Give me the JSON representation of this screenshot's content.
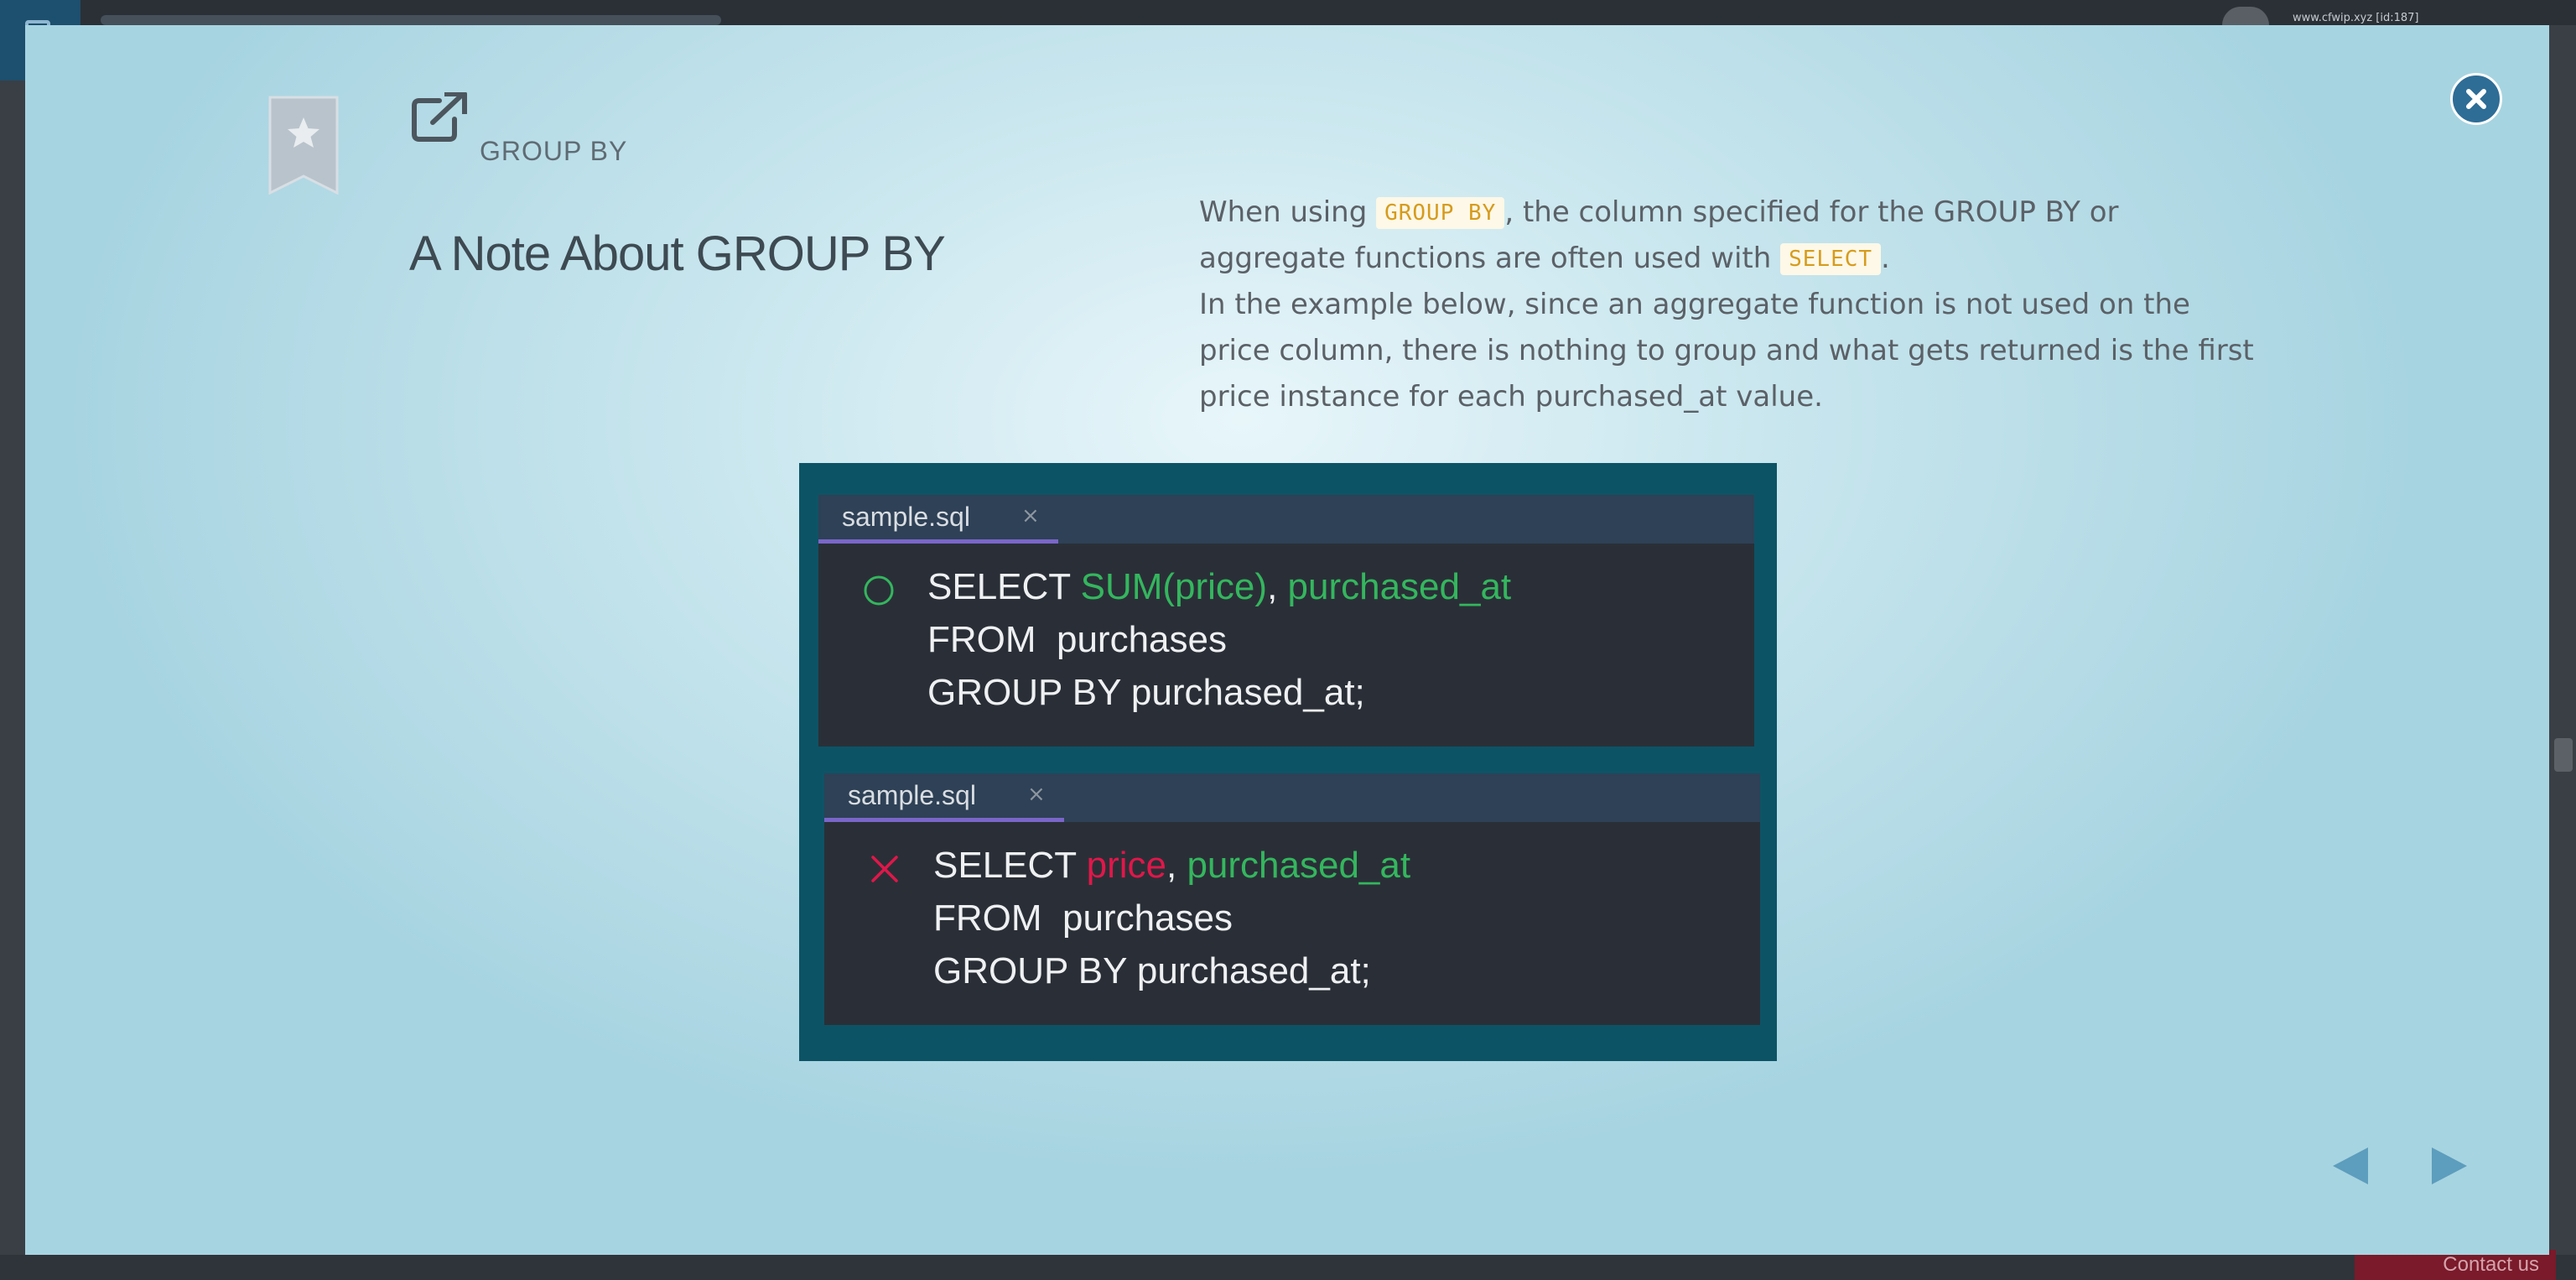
{
  "background": {
    "user_link": "www.cfwip.xyz [id:187]",
    "contact_label": "Contact us"
  },
  "modal": {
    "section_label": "GROUP BY",
    "title": "A Note About GROUP BY",
    "description": {
      "p1_prefix": "When using ",
      "p1_code1": "GROUP BY",
      "p1_mid": ", the column specified for the GROUP BY or aggregate functions are often used with ",
      "p1_code2": "SELECT",
      "p1_suffix": ".",
      "p2": "In the example below, since an aggregate function is not used on the price column, there is nothing to group and what gets returned is the first price instance for each purchased_at value."
    },
    "icons": {
      "close": "close-icon",
      "bookmark": "bookmark-star-icon",
      "external": "external-link-icon",
      "prev": "arrow-left-icon",
      "next": "arrow-right-icon"
    },
    "examples": [
      {
        "tab_name": "sample.sql",
        "tab_close": "×",
        "status": "correct",
        "line1_keyword": "SELECT ",
        "line1_col1": "SUM(price)",
        "line1_sep": ", ",
        "line1_col2": "purchased_at",
        "line2": "FROM  purchases",
        "line3": "GROUP BY purchased_at;"
      },
      {
        "tab_name": "sample.sql",
        "tab_close": "×",
        "status": "incorrect",
        "line1_keyword": "SELECT ",
        "line1_col1": "price",
        "line1_sep": ", ",
        "line1_col2": "purchased_at",
        "line2": "FROM  purchases",
        "line3": "GROUP BY purchased_at;"
      }
    ],
    "colors": {
      "accent": "#2e6d96",
      "code_green": "#34b65e",
      "code_red": "#e0174a",
      "inline_code": "#d69b1d",
      "illustration_bg": "#0d5366"
    }
  }
}
